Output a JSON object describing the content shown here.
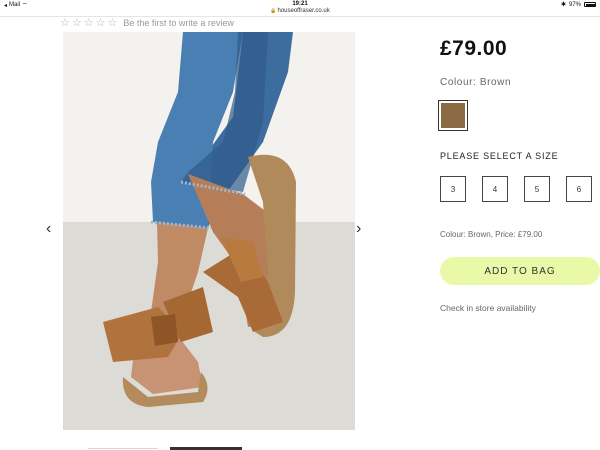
{
  "status_bar": {
    "back_app": "Mail",
    "time": "19:21",
    "battery": "97%"
  },
  "browser": {
    "url": "houseoffraser.co.uk"
  },
  "reviews": {
    "text": "Be the first to write a review",
    "rating": 0,
    "max_rating": 5
  },
  "product": {
    "price": "£79.00",
    "colour_label": "Colour: Brown",
    "swatch_color": "#8b6b43",
    "size_heading": "PLEASE SELECT A SIZE",
    "sizes": [
      "3",
      "4",
      "5",
      "6"
    ],
    "price_line": "Colour: Brown, Price: £79.00",
    "add_to_bag": "ADD TO BAG",
    "store_link": "Check in store availability"
  },
  "gallery": {
    "prev_icon": "chevron-left-icon",
    "next_icon": "chevron-right-icon",
    "image_alt": "Brown suede bow sandals worn with cropped jeans"
  },
  "colors": {
    "button_bg": "#e9f9a8",
    "text_primary": "#111111",
    "text_muted": "#666666"
  }
}
